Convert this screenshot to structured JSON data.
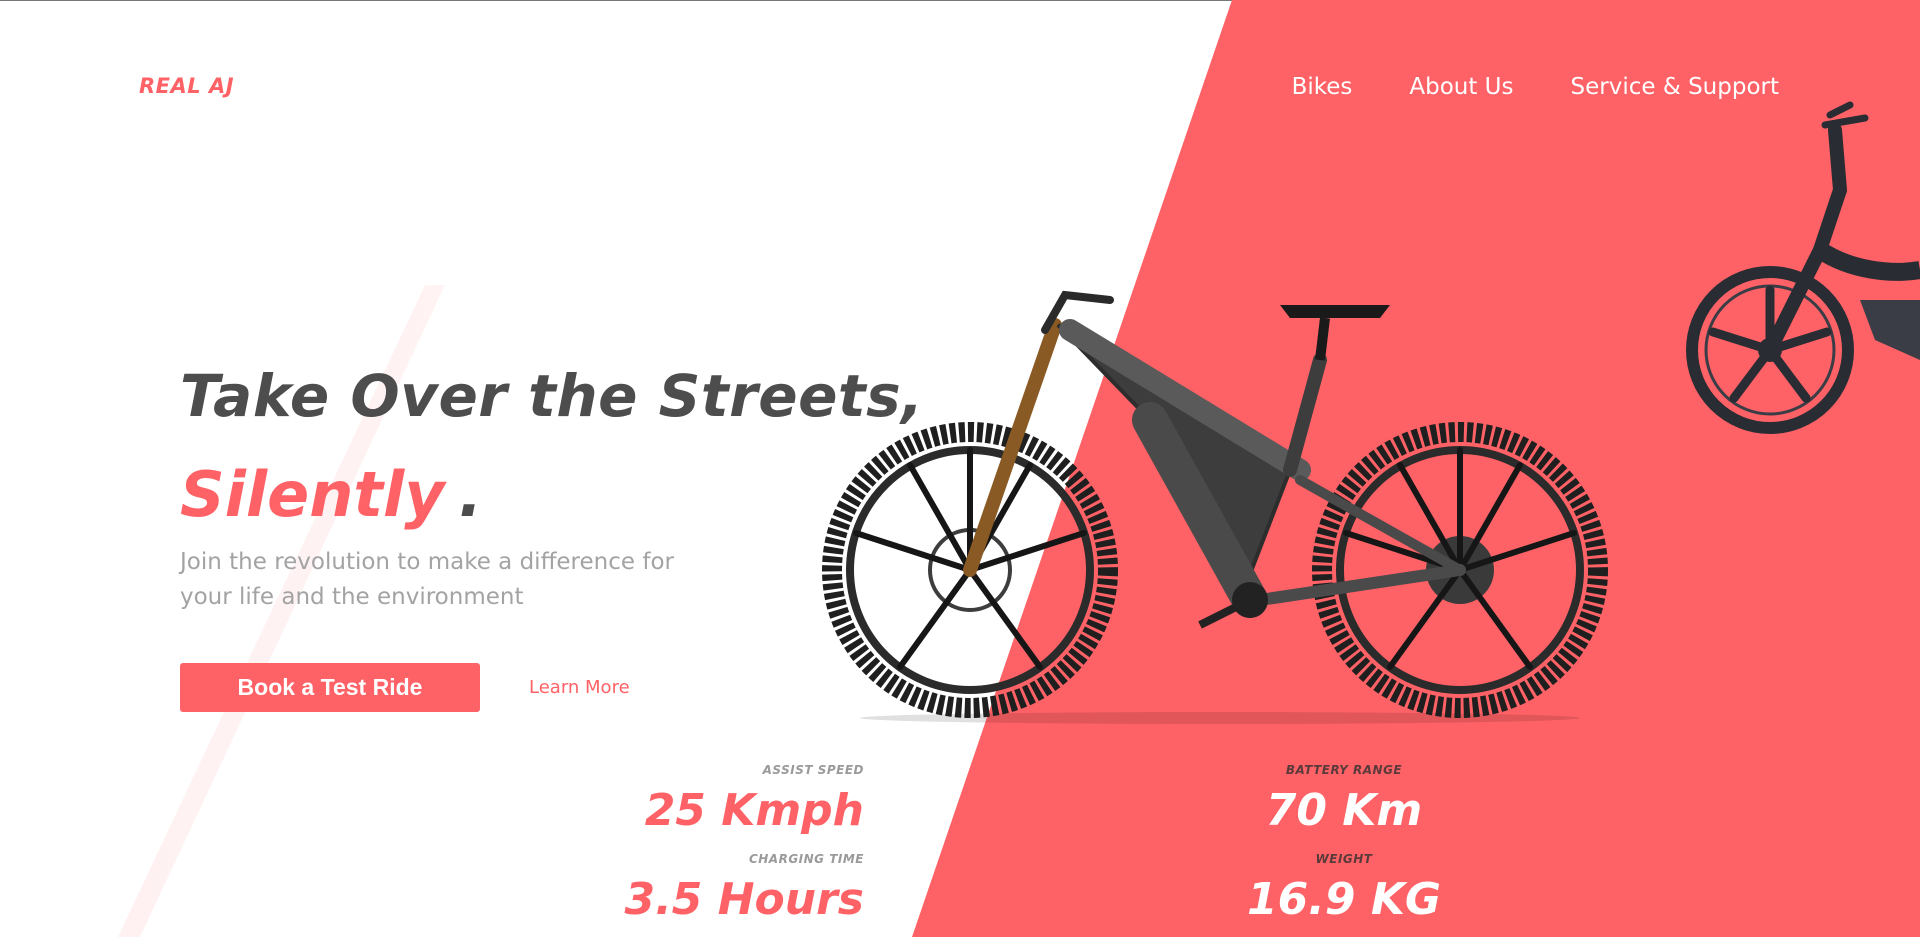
{
  "nav": {
    "logo": "REAL AJ",
    "items": [
      {
        "label": "Bikes"
      },
      {
        "label": "About Us"
      },
      {
        "label": "Service & Support"
      }
    ]
  },
  "hero": {
    "headline": "Take Over the Streets,",
    "accent_word": "Silently",
    "accent_punct": ".",
    "subtext": "Join the revolution to make a difference for your life and the environment",
    "primary_button": "Book a Test Ride",
    "secondary_link": "Learn More"
  },
  "stats": [
    {
      "label": "ASSIST SPEED",
      "value": "25 Kmph"
    },
    {
      "label": "BATTERY RANGE",
      "value": "70 Km"
    },
    {
      "label": "CHARGING TIME",
      "value": "3.5 Hours"
    },
    {
      "label": "WEIGHT",
      "value": "16.9 KG"
    }
  ],
  "colors": {
    "accent": "#ff6266",
    "heading": "#4d4d4d",
    "muted": "#a3a3a3",
    "white": "#ffffff"
  },
  "icons": {
    "hero_image": "mountain-ebike-icon",
    "secondary_image": "city-ebike-icon"
  }
}
